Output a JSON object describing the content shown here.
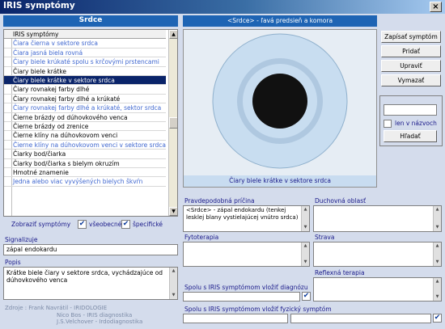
{
  "window": {
    "title": "IRIS symptómy",
    "close": "×"
  },
  "left_header": "Srdce",
  "symptoms": {
    "header": "IRIS symptómy",
    "rows": [
      {
        "label": "Čiara čierna v sektore srdca",
        "blue": true
      },
      {
        "label": "Čiara jasná biela rovná",
        "blue": true
      },
      {
        "label": "Čiary biele krúkaté spolu s krčovými prstencami",
        "blue": true
      },
      {
        "label": "Čiary biele krátke",
        "blue": false
      },
      {
        "label": "Čiary biele krátke v sektore srdca",
        "sel": true
      },
      {
        "label": "Čiary rovnakej farby dlhé",
        "blue": false
      },
      {
        "label": "Čiary rovnakej farby dlhé a krúkaté",
        "blue": false
      },
      {
        "label": "Čiary rovnakej farby dlhé a krúkaté, sektor srdca",
        "blue": true
      },
      {
        "label": "Čierne brázdy od dúhovkového venca",
        "blue": false
      },
      {
        "label": "Čierne brázdy od zrenice",
        "blue": false
      },
      {
        "label": "Čierne klíny na dúhovkovom venci",
        "blue": false
      },
      {
        "label": "Čierne klíny na dúhovkovom venci v sektore srdca",
        "blue": true
      },
      {
        "label": "Čiarky bod/čiarka",
        "blue": false
      },
      {
        "label": "Čiarky bod/čiarka s bielym okruzím",
        "blue": false
      },
      {
        "label": "Hmotné znamenie",
        "blue": false
      },
      {
        "label": "Jedna alebo viac vyvýšených bielych škvŕn",
        "blue": true
      }
    ]
  },
  "filters": {
    "show_label": "Zobraziť symptómy",
    "general": "všeobecné",
    "specific": "špecifické",
    "check": "✔"
  },
  "signalizuje": {
    "label": "Signalizuje",
    "value": "zápal endokardu"
  },
  "popis": {
    "label": "Popis",
    "value": "Krátke biele čiary v sektore srdca, vychádzajúce od dúhovkového venca"
  },
  "zdroje": {
    "line1": "Zdroje : Frank Navrátil - IRIDOLOGIE",
    "line2": "Nico Bos - IRIS diagnostika",
    "line3": "J.S.Velchover - Irdodiagnostika"
  },
  "image": {
    "header": "<Srdce> - ľavá predsieň a komora",
    "caption": "Čiary biele krátke v sektore srdca"
  },
  "buttons": {
    "save": "Zapísať symptóm",
    "add": "Pridať",
    "edit": "Upraviť",
    "delete": "Vymazať"
  },
  "search": {
    "value": "",
    "names_only": "len v názvoch",
    "find": "Hľadať"
  },
  "cause": {
    "label": "Pravdepodobná príčina",
    "value": "<Srdce> - zápal endokardu (tenkej lesklej blany vystielajúcej vnútro srdca)"
  },
  "spiritual": {
    "label": "Duchovná oblasť"
  },
  "phyto": {
    "label": "Fytoterapia"
  },
  "diet": {
    "label": "Strava"
  },
  "reflex": {
    "label": "Reflexná terapia"
  },
  "diag": {
    "label": "Spolu s IRIS symptómom vložiť diagnózu"
  },
  "physical": {
    "label": "Spolu s IRIS symptómom vložiť fyzický symptóm"
  },
  "colors": {
    "accent": "#1E64B4",
    "selection": "#0A246A",
    "iris": "#C8DDF0",
    "eye_bg": "#E6EDF4"
  }
}
